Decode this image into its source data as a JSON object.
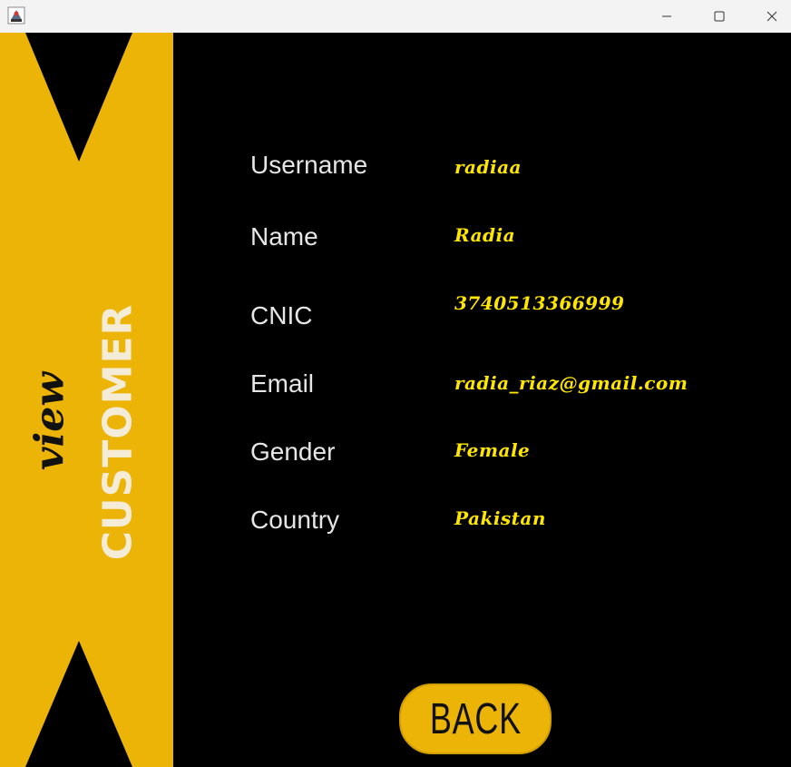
{
  "window": {
    "controls": {
      "minimize_icon": "minimize-icon",
      "maximize_icon": "maximize-icon",
      "close_icon": "close-icon"
    }
  },
  "banner": {
    "title_big": "CUSTOMER",
    "title_script": "view",
    "color": "#ecb407"
  },
  "fields": [
    {
      "label": "Username",
      "value": "radiaa"
    },
    {
      "label": "Name",
      "value": "Radia"
    },
    {
      "label": "CNIC",
      "value": "3740513366999"
    },
    {
      "label": "Email",
      "value": "radia_riaz@gmail.com"
    },
    {
      "label": "Gender",
      "value": "Female"
    },
    {
      "label": "Country",
      "value": "Pakistan"
    }
  ],
  "back_button": {
    "label": "BACK"
  },
  "colors": {
    "background": "#000000",
    "accent": "#ecb407",
    "value_text": "#ffe600",
    "label_text": "#e6e6e6"
  }
}
